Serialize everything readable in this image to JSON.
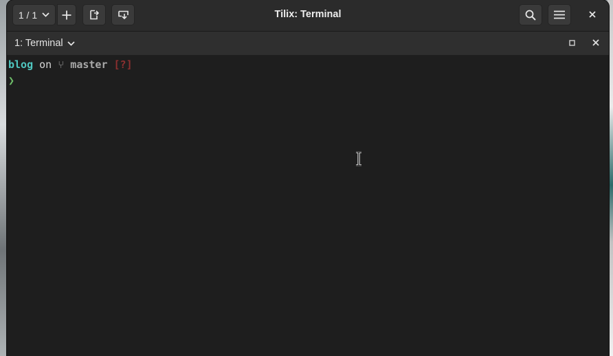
{
  "window": {
    "title": "Tilix: Terminal"
  },
  "headerbar": {
    "session_counter": "1 / 1",
    "buttons": {
      "add_session": "plus-icon",
      "split_right": "split-right-icon",
      "split_down": "split-down-icon",
      "search": "search-icon",
      "menu": "hamburger-menu-icon",
      "close": "close-icon"
    }
  },
  "terminal_tab": {
    "title": "1: Terminal",
    "maximize_icon": "maximize-icon",
    "close_icon": "close-icon"
  },
  "terminal": {
    "prompt_line": {
      "directory": "blog",
      "on_word": "on",
      "branch_symbol": "",
      "branch": "master",
      "git_status": "[?]"
    },
    "input_line": {
      "prompt_char": "❯",
      "input": ""
    }
  },
  "colors": {
    "directory": "#4fc7c0",
    "git_status": "#8c2f2f",
    "prompt": "#6fbf6a",
    "terminal_bg": "#1e1e1e",
    "headerbar_bg": "#2b2b2b"
  }
}
